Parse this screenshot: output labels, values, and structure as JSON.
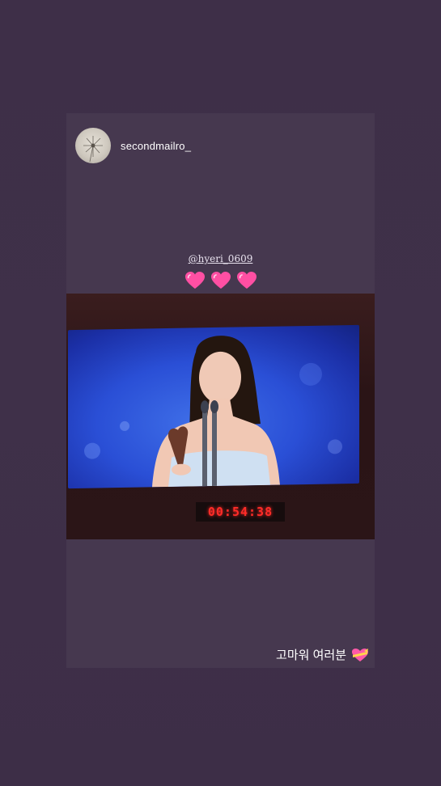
{
  "story": {
    "username": "secondmailro_",
    "mention": "@hyeri_0609",
    "caption": "고마워 여러분",
    "timer": "00:54:38"
  },
  "icons": {
    "hearts": [
      "sparkling-heart-icon",
      "sparkling-heart-icon",
      "sparkling-heart-icon"
    ],
    "caption_emoji": "heart-with-ribbon-icon"
  },
  "colors": {
    "background": "#3f3049",
    "card": "#46384f",
    "heart": "#ff4fa3",
    "timer": "#ff2c28"
  }
}
